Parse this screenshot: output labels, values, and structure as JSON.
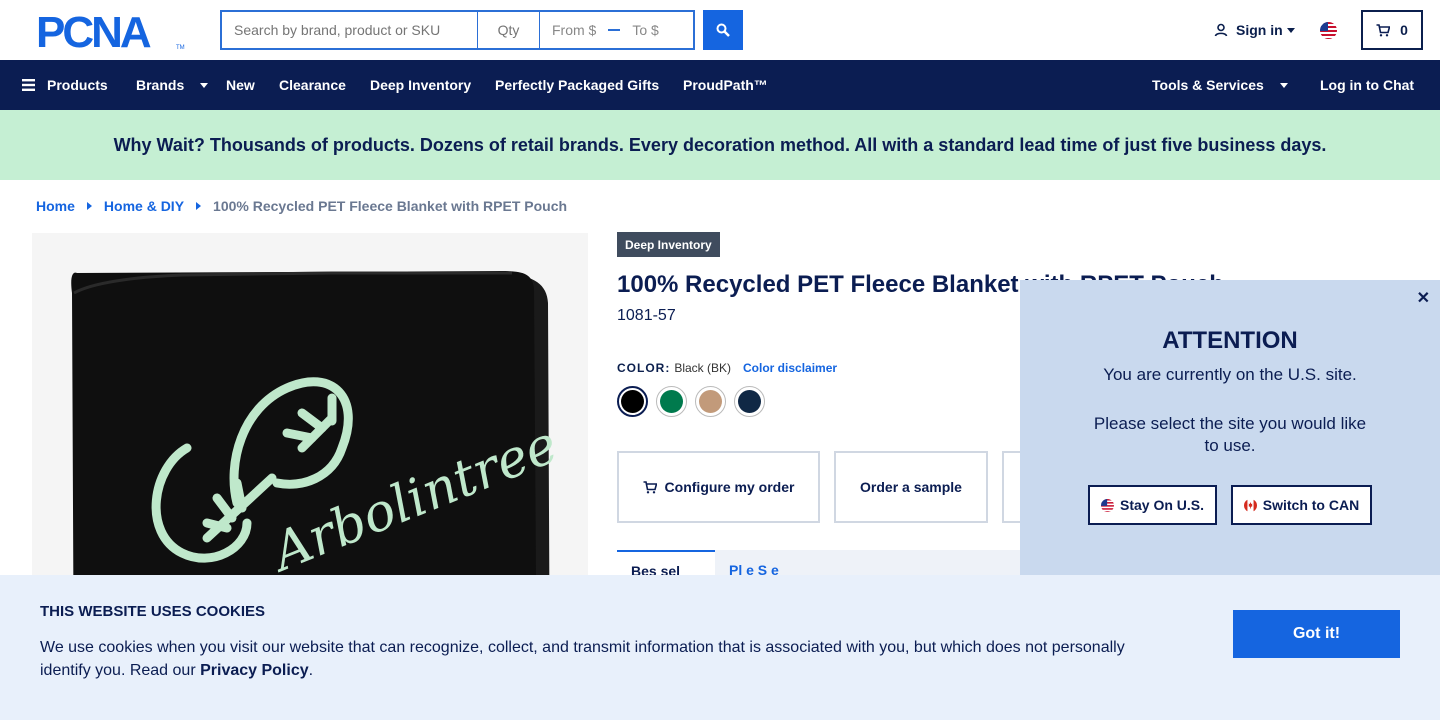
{
  "header": {
    "logo_text": "PCNA",
    "search_placeholder": "Search by brand, product or SKU",
    "qty_placeholder": "Qty",
    "from_placeholder": "From $",
    "to_placeholder": "To $",
    "signin_label": "Sign in",
    "cart_count": "0"
  },
  "nav": {
    "products": "Products",
    "brands": "Brands",
    "new": "New",
    "clearance": "Clearance",
    "deep_inventory": "Deep Inventory",
    "gifts": "Perfectly Packaged Gifts",
    "proudpath": "ProudPath™",
    "tools": "Tools & Services",
    "chat": "Log in to Chat"
  },
  "promo": {
    "text": "Why Wait? Thousands of products. Dozens of retail brands. Every decoration method. All with a standard lead time of just five business days."
  },
  "breadcrumb": {
    "home": "Home",
    "category": "Home & DIY",
    "current": "100% Recycled PET Fleece Blanket with RPET Pouch"
  },
  "product": {
    "badge": "Deep Inventory",
    "title": "100% Recycled PET Fleece Blanket with RPET Pouch",
    "sku": "1081-57",
    "color_label": "COLOR:",
    "color_value": "Black (BK)",
    "color_disclaimer": "Color disclaimer",
    "image_text": "Arbolintree",
    "swatches": [
      {
        "name": "Black",
        "color": "#000000"
      },
      {
        "name": "Green",
        "color": "#007a4d"
      },
      {
        "name": "Tan",
        "color": "#c29a7a"
      },
      {
        "name": "Navy",
        "color": "#102845"
      }
    ],
    "actions": {
      "configure": "Configure my order",
      "sample": "Order a sample"
    },
    "tabs": {
      "tab1": "Bes  sel",
      "tab2": "Pl    e  S    e"
    }
  },
  "modal": {
    "title": "ATTENTION",
    "text1": "You are currently on the U.S. site.",
    "text2": "Please select the site you would like to use.",
    "stay_label": "Stay On U.S.",
    "switch_label": "Switch to CAN"
  },
  "cookie": {
    "title": "THIS WEBSITE USES COOKIES",
    "text": "We use cookies when you visit our website that can recognize, collect, and transmit information that is associated with you, but which does not personally identify you. Read our ",
    "link": "Privacy Policy",
    "end": ".",
    "button": "Got it!"
  },
  "colors": {
    "navy": "#0b1d52",
    "blue": "#1565e0",
    "promo_bg": "#c5efd3",
    "modal_bg": "#c9d9ee",
    "cookie_bg": "#e8f0fb"
  }
}
